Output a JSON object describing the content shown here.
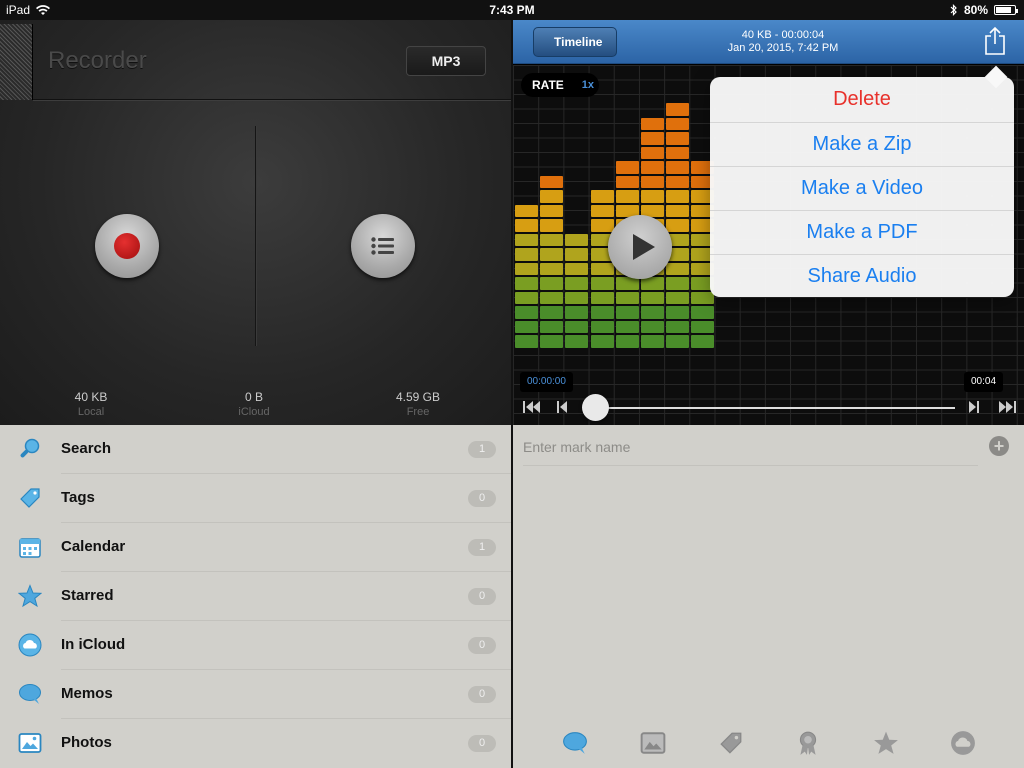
{
  "status_bar": {
    "device": "iPad",
    "time": "7:43 PM",
    "battery": "80%"
  },
  "recorder": {
    "title": "Recorder",
    "format_button": "MP3",
    "stats": [
      {
        "value": "40 KB",
        "label": "Local"
      },
      {
        "value": "0 B",
        "label": "iCloud"
      },
      {
        "value": "4.59 GB",
        "label": "Free"
      }
    ],
    "record_icon": "record-icon",
    "list_icon": "list-icon"
  },
  "sidebar": {
    "items": [
      {
        "label": "Search",
        "count": "1",
        "icon": "search-icon"
      },
      {
        "label": "Tags",
        "count": "0",
        "icon": "tag-icon"
      },
      {
        "label": "Calendar",
        "count": "1",
        "icon": "calendar-icon"
      },
      {
        "label": "Starred",
        "count": "0",
        "icon": "star-icon"
      },
      {
        "label": "In iCloud",
        "count": "0",
        "icon": "cloud-icon"
      },
      {
        "label": "Memos",
        "count": "0",
        "icon": "speech-bubble-icon"
      },
      {
        "label": "Photos",
        "count": "0",
        "icon": "photo-icon"
      }
    ]
  },
  "player": {
    "back_label": "Timeline",
    "info_line1": "40 KB - 00:00:04",
    "info_line2": "Jan 20, 2015, 7:42 PM",
    "rate_label": "RATE",
    "rate_value": "1x",
    "time_start": "00:00:00",
    "time_end": "00:04",
    "progress": 0.0
  },
  "share_menu": {
    "items": [
      {
        "label": "Delete",
        "style": "destructive"
      },
      {
        "label": "Make a Zip",
        "style": "default"
      },
      {
        "label": "Make a Video",
        "style": "default"
      },
      {
        "label": "Make a PDF",
        "style": "default"
      },
      {
        "label": "Share Audio",
        "style": "default"
      }
    ]
  },
  "marks": {
    "placeholder": "Enter mark name",
    "tab_icons": [
      "speech-bubble-icon",
      "photo-icon",
      "tag-icon",
      "badge-icon",
      "star-icon",
      "cloud-icon"
    ]
  },
  "colors": {
    "accent_blue": "#1a7ff0",
    "destructive_red": "#e8312b",
    "nav_blue": "#2c64a6",
    "record_red": "#c41818"
  }
}
